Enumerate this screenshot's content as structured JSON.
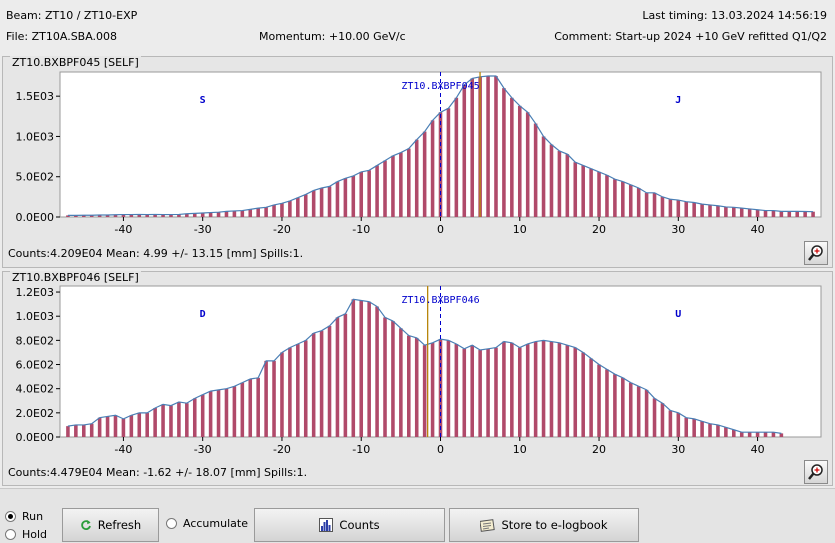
{
  "header": {
    "beam": "Beam:  ZT10 / ZT10-EXP",
    "last_timing": "Last timing: 13.03.2024 14:56:19",
    "file": "File:  ZT10A.SBA.008",
    "momentum": "Momentum: +10.00 GeV/c",
    "comment": "Comment: Start-up 2024 +10 GeV refitted Q1/Q2"
  },
  "panels": [
    {
      "title": "ZT10.BXBPF045 [SELF]",
      "monitor_label": "ZT10.BXBPF045",
      "left_marker": "S",
      "right_marker": "J",
      "stats": "Counts:4.209E04  Mean: 4.99 +/- 13.15 [mm]  Spills:1."
    },
    {
      "title": "ZT10.BXBPF046 [SELF]",
      "monitor_label": "ZT10.BXBPF046",
      "left_marker": "D",
      "right_marker": "U",
      "stats": "Counts:4.479E04  Mean: -1.62 +/- 18.07 [mm]  Spills:1."
    }
  ],
  "controls": {
    "run_label": "Run",
    "hold_label": "Hold",
    "mode_selected": "Run",
    "refresh_label": "Refresh",
    "accumulate_label": "Accumulate",
    "accumulate_checked": false,
    "counts_label": "Counts",
    "logbook_label": "Store to e-logbook"
  },
  "colors": {
    "bar": "#b04a6a",
    "envelope": "#4a7fb5",
    "center_line": "#0000cc",
    "mean_line": "#b8860b"
  },
  "chart_data": [
    {
      "type": "bar",
      "title": "ZT10.BXBPF045 [SELF]",
      "xlabel": "",
      "ylabel": "",
      "xlim": [
        -48,
        48
      ],
      "ylim": [
        0,
        1800
      ],
      "x_ticks": [
        -40,
        -30,
        -20,
        -10,
        0,
        10,
        20,
        30,
        40
      ],
      "y_ticks": [
        0,
        500,
        1000,
        1500
      ],
      "y_tick_labels": [
        "0.0E00",
        "5.0E02",
        "1.0E03",
        "1.5E03"
      ],
      "mean": 4.99,
      "x": [
        -47,
        -46,
        -45,
        -44,
        -43,
        -42,
        -41,
        -40,
        -39,
        -38,
        -37,
        -36,
        -35,
        -34,
        -33,
        -32,
        -31,
        -30,
        -29,
        -28,
        -27,
        -26,
        -25,
        -24,
        -23,
        -22,
        -21,
        -20,
        -19,
        -18,
        -17,
        -16,
        -15,
        -14,
        -13,
        -12,
        -11,
        -10,
        -9,
        -8,
        -7,
        -6,
        -5,
        -4,
        -3,
        -2,
        -1,
        0,
        1,
        2,
        3,
        4,
        5,
        6,
        7,
        8,
        9,
        10,
        11,
        12,
        13,
        14,
        15,
        16,
        17,
        18,
        19,
        20,
        21,
        22,
        23,
        24,
        25,
        26,
        27,
        28,
        29,
        30,
        31,
        32,
        33,
        34,
        35,
        36,
        37,
        38,
        39,
        40,
        41,
        42,
        43,
        44,
        45,
        46,
        47
      ],
      "values": [
        20,
        20,
        22,
        22,
        25,
        25,
        28,
        30,
        30,
        32,
        30,
        32,
        30,
        30,
        32,
        40,
        45,
        50,
        55,
        60,
        70,
        75,
        80,
        95,
        110,
        120,
        150,
        170,
        200,
        240,
        280,
        330,
        360,
        380,
        440,
        480,
        510,
        560,
        580,
        640,
        700,
        760,
        800,
        850,
        960,
        1060,
        1200,
        1300,
        1350,
        1480,
        1640,
        1720,
        1740,
        1750,
        1750,
        1600,
        1480,
        1380,
        1300,
        1160,
        1000,
        900,
        820,
        780,
        680,
        640,
        600,
        560,
        520,
        470,
        440,
        400,
        360,
        300,
        300,
        250,
        220,
        210,
        190,
        180,
        160,
        150,
        140,
        125,
        120,
        110,
        100,
        90,
        80,
        80,
        70,
        70,
        70,
        68,
        66
      ]
    },
    {
      "type": "bar",
      "title": "ZT10.BXBPF046 [SELF]",
      "xlabel": "",
      "ylabel": "",
      "xlim": [
        -48,
        48
      ],
      "ylim": [
        0,
        1250
      ],
      "x_ticks": [
        -40,
        -30,
        -20,
        -10,
        0,
        10,
        20,
        30,
        40
      ],
      "y_ticks": [
        0,
        200,
        400,
        600,
        800,
        1000,
        1200
      ],
      "y_tick_labels": [
        "0.0E00",
        "2.0E02",
        "4.0E02",
        "6.0E02",
        "8.0E02",
        "1.0E03",
        "1.2E03"
      ],
      "mean": -1.62,
      "x": [
        -47,
        -46,
        -45,
        -44,
        -43,
        -42,
        -41,
        -40,
        -39,
        -38,
        -37,
        -36,
        -35,
        -34,
        -33,
        -32,
        -31,
        -30,
        -29,
        -28,
        -27,
        -26,
        -25,
        -24,
        -23,
        -22,
        -21,
        -20,
        -19,
        -18,
        -17,
        -16,
        -15,
        -14,
        -13,
        -12,
        -11,
        -10,
        -9,
        -8,
        -7,
        -6,
        -5,
        -4,
        -3,
        -2,
        -1,
        0,
        1,
        2,
        3,
        4,
        5,
        6,
        7,
        8,
        9,
        10,
        11,
        12,
        13,
        14,
        15,
        16,
        17,
        18,
        19,
        20,
        21,
        22,
        23,
        24,
        25,
        26,
        27,
        28,
        29,
        30,
        31,
        32,
        33,
        34,
        35,
        36,
        37,
        38,
        39,
        40,
        41,
        42,
        43,
        44,
        45,
        46,
        47
      ],
      "values": [
        90,
        100,
        100,
        110,
        160,
        170,
        180,
        150,
        180,
        200,
        200,
        240,
        270,
        260,
        290,
        280,
        320,
        350,
        380,
        390,
        400,
        420,
        450,
        480,
        490,
        630,
        630,
        700,
        740,
        770,
        800,
        860,
        880,
        920,
        990,
        1020,
        1140,
        1130,
        1120,
        1080,
        990,
        960,
        900,
        840,
        820,
        760,
        780,
        810,
        800,
        770,
        730,
        760,
        720,
        730,
        740,
        790,
        780,
        740,
        770,
        790,
        800,
        790,
        780,
        760,
        740,
        700,
        650,
        600,
        560,
        520,
        490,
        450,
        420,
        390,
        320,
        280,
        220,
        200,
        160,
        150,
        130,
        110,
        100,
        80,
        60,
        40,
        40,
        40,
        40,
        40,
        30
      ]
    }
  ]
}
